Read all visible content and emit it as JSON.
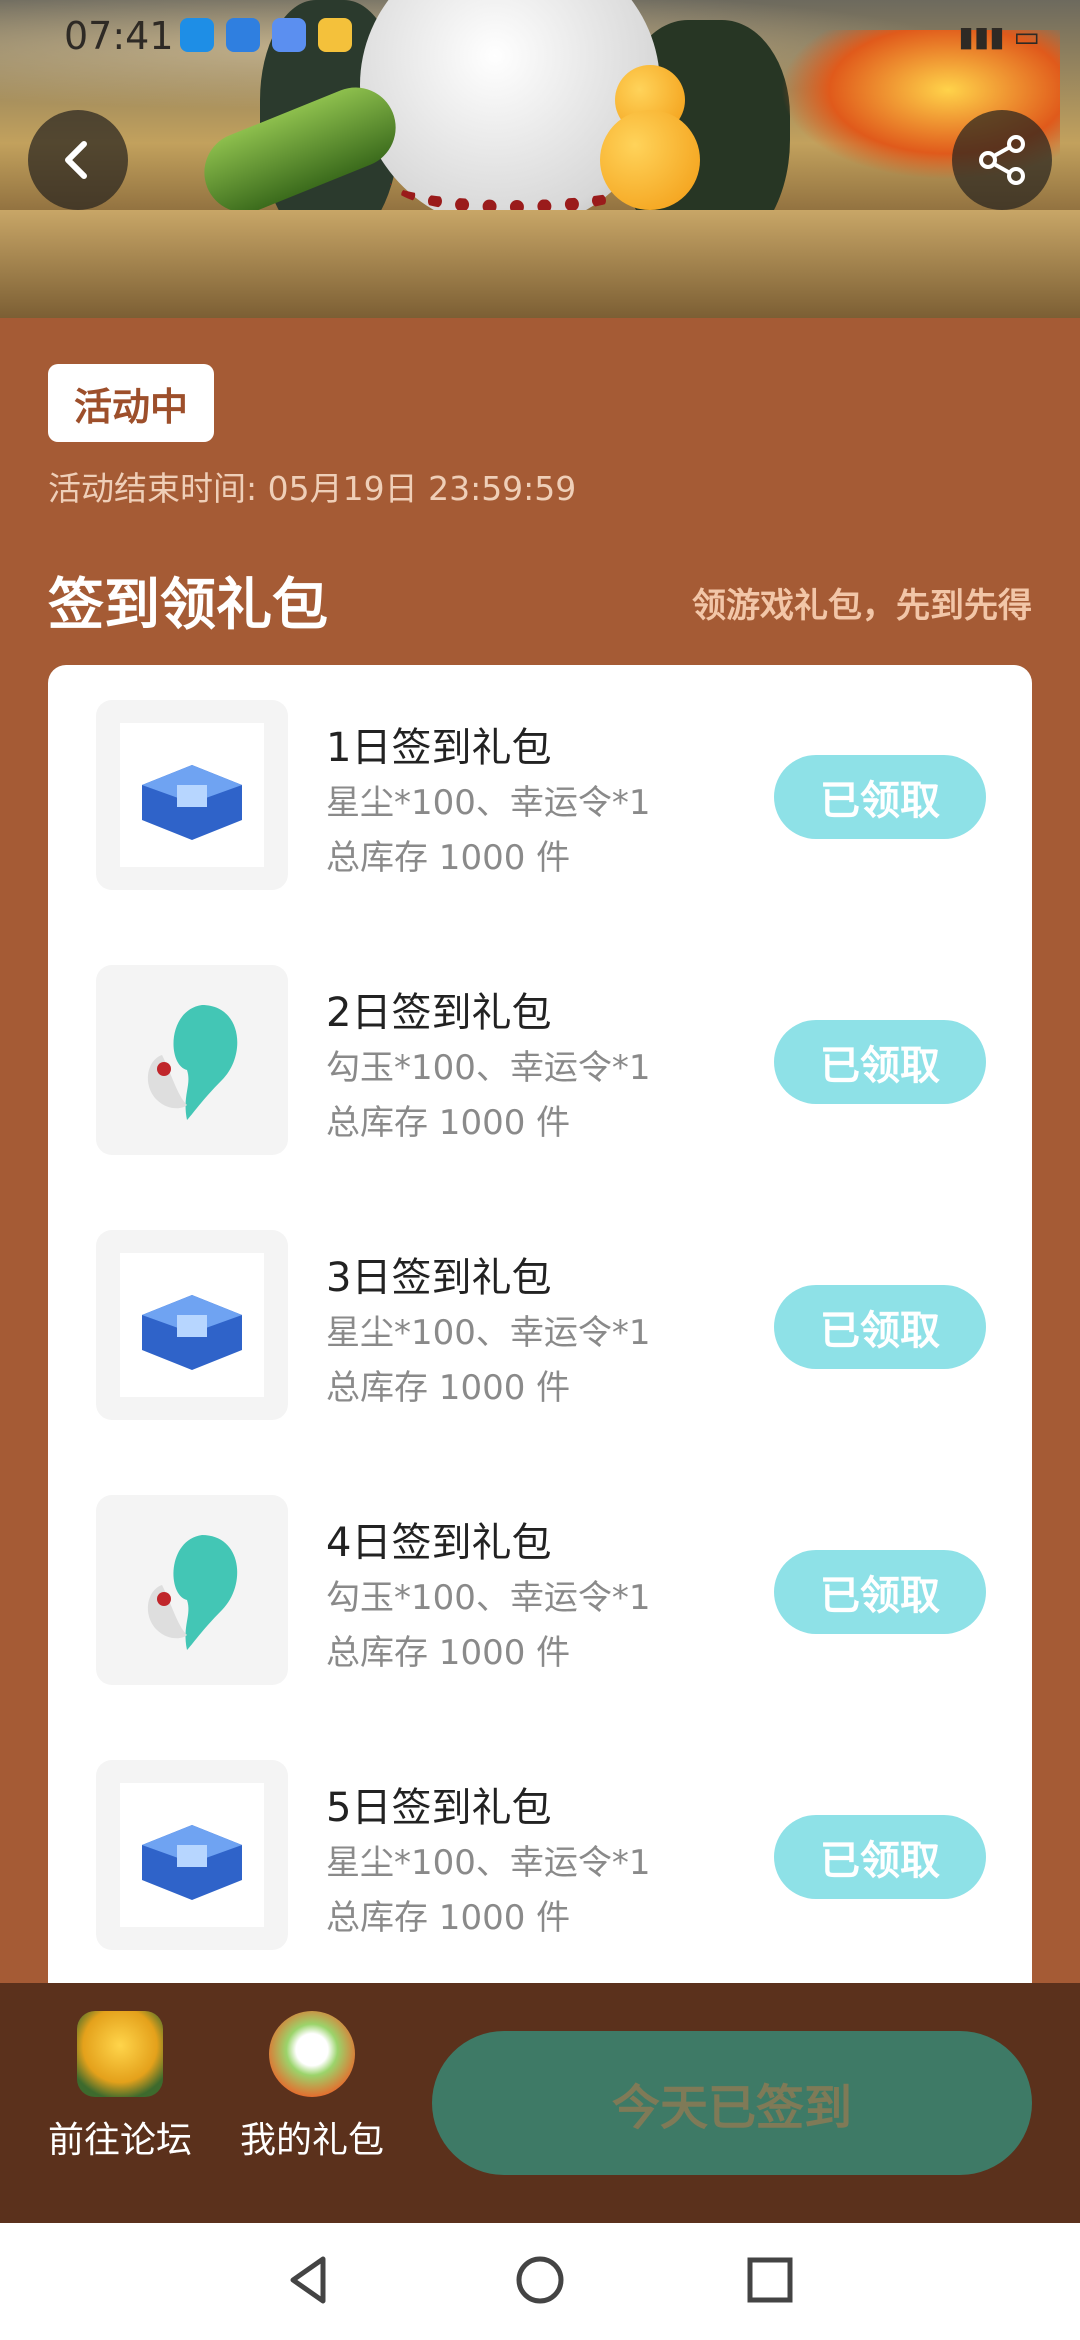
{
  "status_bar": {
    "time": "07:41"
  },
  "header": {
    "back_icon": "chevron-left-icon",
    "share_icon": "share-icon"
  },
  "activity": {
    "status_badge": "活动中",
    "end_time": "活动结束时间: 05月19日 23:59:59"
  },
  "section": {
    "title": "签到领礼包",
    "subtitle": "领游戏礼包，先到先得"
  },
  "gifts": [
    {
      "title": "1日签到礼包",
      "desc": "星尘*100、幸运令*1",
      "stock": "总库存 1000 件",
      "button": "已领取",
      "icon": "blue-chest-icon"
    },
    {
      "title": "2日签到礼包",
      "desc": "勾玉*100、幸运令*1",
      "stock": "总库存 1000 件",
      "button": "已领取",
      "icon": "jade-magatama-icon"
    },
    {
      "title": "3日签到礼包",
      "desc": "星尘*100、幸运令*1",
      "stock": "总库存 1000 件",
      "button": "已领取",
      "icon": "blue-chest-icon"
    },
    {
      "title": "4日签到礼包",
      "desc": "勾玉*100、幸运令*1",
      "stock": "总库存 1000 件",
      "button": "已领取",
      "icon": "jade-magatama-icon"
    },
    {
      "title": "5日签到礼包",
      "desc": "星尘*100、幸运令*1",
      "stock": "总库存 1000 件",
      "button": "已领取",
      "icon": "blue-chest-icon"
    }
  ],
  "bottom_bar": {
    "forum_label": "前往论坛",
    "my_gifts_label": "我的礼包",
    "signed_button": "今天已签到"
  },
  "colors": {
    "page_background": "#a55b35",
    "claimed_button": "#8ee1e7",
    "signed_button": "#3e7a66",
    "bottom_bar": "#5b311c"
  }
}
